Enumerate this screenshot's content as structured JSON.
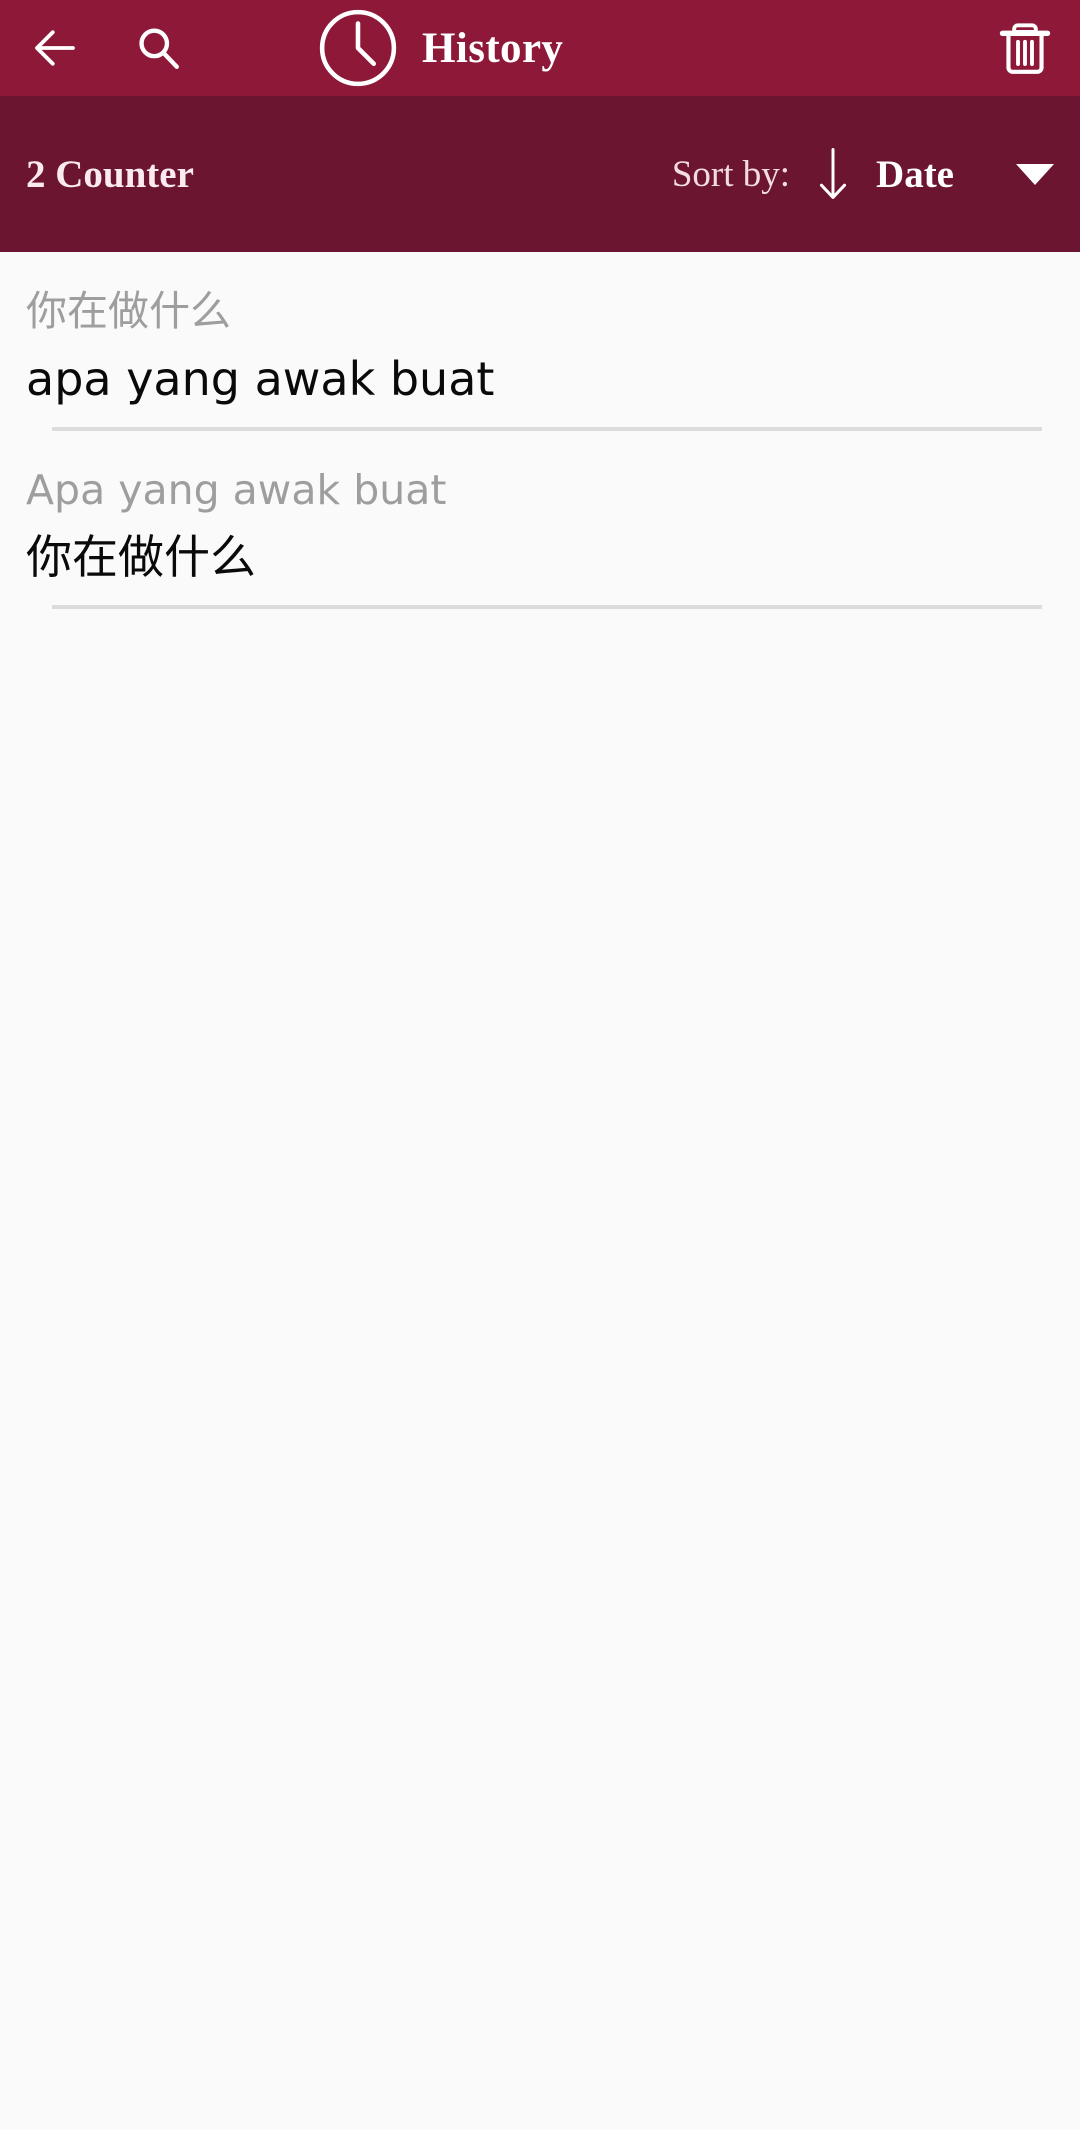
{
  "toolbar": {
    "back_icon": "arrow-left-icon",
    "search_icon": "search-icon",
    "clock_icon": "clock-icon",
    "title": "History",
    "delete_icon": "trash-icon",
    "background_color": "#8E1838"
  },
  "sortbar": {
    "counter_label": "2 Counter",
    "sort_by_label": "Sort by:",
    "sort_direction_icon": "arrow-down-icon",
    "sort_value": "Date",
    "dropdown_icon": "caret-down-icon",
    "background_color": "#6B1531"
  },
  "history": {
    "items": [
      {
        "source_text": "你在做什么",
        "translated_text": "apa yang awak buat"
      },
      {
        "source_text": "Apa yang awak buat",
        "translated_text": "你在做什么"
      }
    ]
  },
  "colors": {
    "accent": "#8E1838",
    "accent_dark": "#6B1531",
    "page_background": "#FAFAFA",
    "source_text": "#9E9E9E",
    "translated_text": "#0A0A0A",
    "divider": "#DCDCDC"
  }
}
